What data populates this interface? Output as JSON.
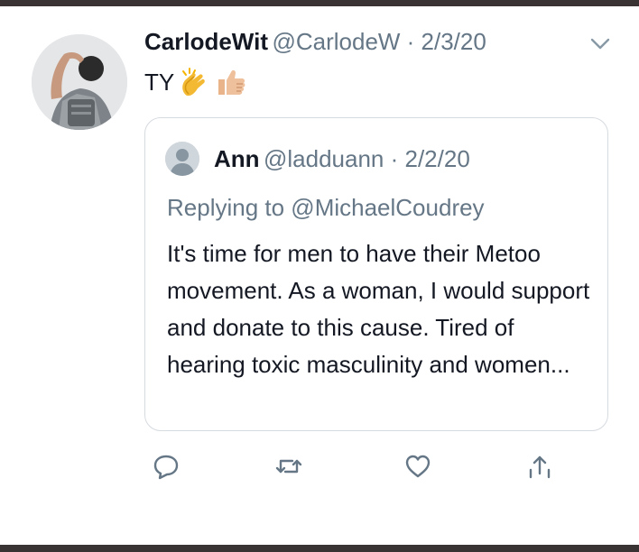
{
  "tweet": {
    "display_name": "CarlodeWit",
    "handle": "@CarlodeW",
    "date": "2/3/20",
    "handle_date": "@CarlodeW · 2/3/20",
    "text": "TY",
    "emojis": [
      "clapping-hands-emoji",
      "thumbs-up-emoji"
    ],
    "quoted": {
      "display_name": "Ann",
      "handle": "@ladduann",
      "date": "2/2/20",
      "handle_date": "@ladduann · 2/2/20",
      "replying_to": "Replying to @MichaelCoudrey",
      "text": "It's time for men to have their Metoo movement. As a woman, I would support and donate to this cause. Tired of hearing toxic masculinity and women..."
    },
    "actions": [
      {
        "name": "reply",
        "icon": "speech-bubble-icon"
      },
      {
        "name": "retweet",
        "icon": "retweet-icon"
      },
      {
        "name": "like",
        "icon": "heart-icon"
      },
      {
        "name": "share",
        "icon": "share-icon"
      }
    ]
  },
  "colors": {
    "primary_text": "#141823",
    "secondary_text": "#657786",
    "border": "#d6dbe0",
    "icon": "#657786"
  }
}
